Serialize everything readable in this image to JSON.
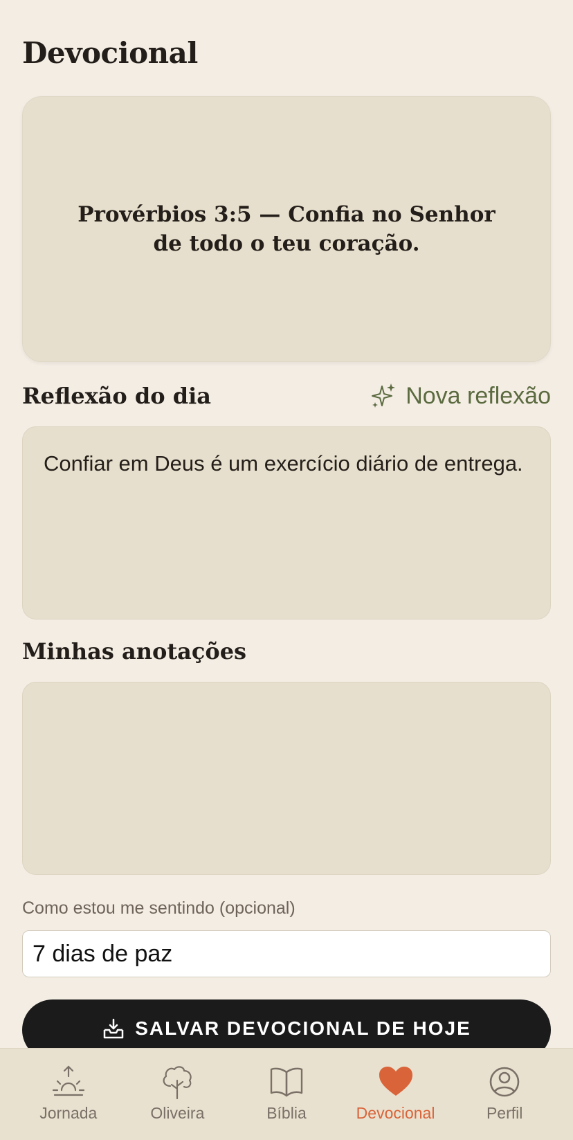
{
  "page": {
    "title": "Devocional"
  },
  "verse": {
    "text": "Provérbios 3:5 — Confia no Senhor de todo o teu coração."
  },
  "reflection": {
    "section_title": "Reflexão do dia",
    "new_button_label": "Nova reflexão",
    "text": "Confiar em Deus é um exercício diário de entrega."
  },
  "notes": {
    "section_title": "Minhas anotações",
    "value": ""
  },
  "feeling": {
    "label": "Como estou me sentindo (opcional)",
    "value": "7 dias de paz"
  },
  "save_button": {
    "label": "SALVAR DEVOCIONAL DE HOJE",
    "icon": "inbox-download-icon"
  },
  "tabs": [
    {
      "label": "Jornada",
      "icon": "sunrise-icon",
      "active": false
    },
    {
      "label": "Oliveira",
      "icon": "tree-icon",
      "active": false
    },
    {
      "label": "Bíblia",
      "icon": "book-icon",
      "active": false
    },
    {
      "label": "Devocional",
      "icon": "heart-icon",
      "active": true
    },
    {
      "label": "Perfil",
      "icon": "person-circle-icon",
      "active": false
    }
  ],
  "colors": {
    "background": "#f3ede4",
    "card": "#e7dfcd",
    "accent_green": "#5b6a3f",
    "active_tab": "#d9643a",
    "button": "#1b1b1b"
  }
}
